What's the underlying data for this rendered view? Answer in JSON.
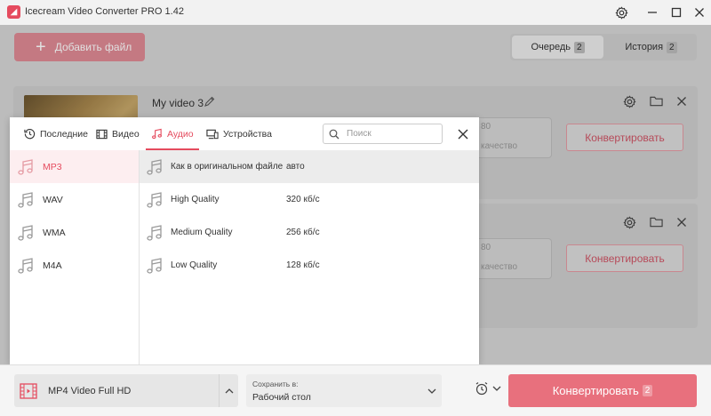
{
  "window": {
    "title": "Icecream Video Converter PRO 1.42"
  },
  "toolbar": {
    "add_file_label": "Добавить файл",
    "tabs": [
      {
        "label": "Очередь",
        "count": "2"
      },
      {
        "label": "История",
        "count": "2"
      }
    ]
  },
  "cards": [
    {
      "name": "My video 3",
      "value_fragment": "80",
      "quality_fragment": "качество",
      "convert_label": "Конвертировать"
    },
    {
      "value_fragment": "80",
      "quality_fragment": "качество",
      "convert_label": "Конвертировать"
    }
  ],
  "popup": {
    "tabs": [
      {
        "label": "Последние",
        "icon": "clock-history-icon"
      },
      {
        "label": "Видео",
        "icon": "film-icon"
      },
      {
        "label": "Аудио",
        "icon": "music-note-icon",
        "active": true
      },
      {
        "label": "Устройства",
        "icon": "devices-icon"
      }
    ],
    "search_placeholder": "Поиск",
    "formats": [
      {
        "label": "MP3",
        "selected": true
      },
      {
        "label": "WAV"
      },
      {
        "label": "WMA"
      },
      {
        "label": "M4A"
      }
    ],
    "qualities": [
      {
        "name": "Как в оригинальном файле",
        "bitrate": "авто",
        "highlighted": true
      },
      {
        "name": "High Quality",
        "bitrate": "320 кб/с"
      },
      {
        "name": "Medium Quality",
        "bitrate": "256 кб/с"
      },
      {
        "name": "Low Quality",
        "bitrate": "128 кб/с"
      }
    ]
  },
  "bottom": {
    "preset_label": "MP4 Video Full HD",
    "save_to_label": "Сохранить в:",
    "save_to_value": "Рабочий стол",
    "convert_label": "Конвертировать",
    "convert_count": "2"
  },
  "colors": {
    "accent": "#e54b5e",
    "accent_light": "#fdeef0"
  }
}
